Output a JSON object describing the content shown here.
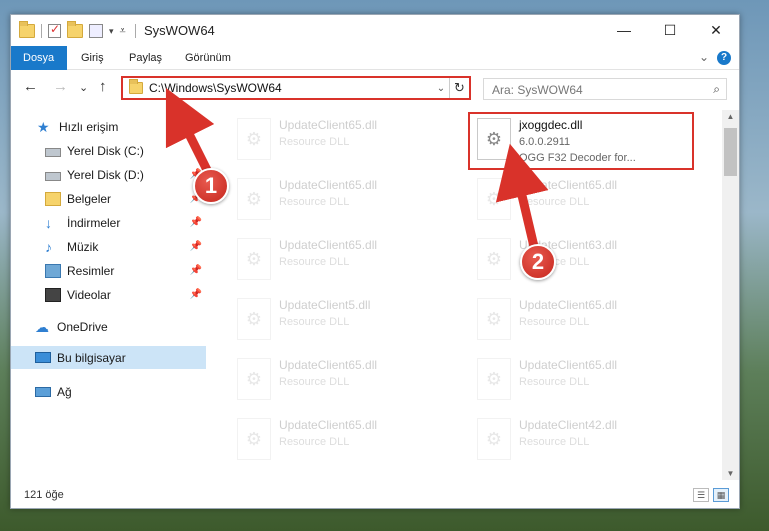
{
  "window": {
    "title": "SysWOW64",
    "minimize": "—",
    "maximize": "☐",
    "close": "✕"
  },
  "ribbon": {
    "tabs": [
      "Dosya",
      "Giriş",
      "Paylaş",
      "Görünüm"
    ],
    "expand": "⌄",
    "help": "?"
  },
  "nav": {
    "back": "←",
    "forward": "→",
    "recent": "⌄",
    "up": "↑",
    "address": "C:\\Windows\\SysWOW64",
    "address_chevron": "⌄",
    "refresh": "↻",
    "search_placeholder": "Ara: SysWOW64",
    "search_icon": "⌕"
  },
  "sidebar": {
    "items": [
      {
        "label": "Hızlı erişim",
        "icon": "star-icon"
      },
      {
        "label": "Yerel Disk (C:)",
        "icon": "disk-icon"
      },
      {
        "label": "Yerel Disk (D:)",
        "icon": "disk-icon"
      },
      {
        "label": "Belgeler",
        "icon": "documents-icon"
      },
      {
        "label": "İndirmeler",
        "icon": "downloads-icon"
      },
      {
        "label": "Müzik",
        "icon": "music-icon"
      },
      {
        "label": "Resimler",
        "icon": "pictures-icon"
      },
      {
        "label": "Videolar",
        "icon": "videos-icon"
      },
      {
        "label": "OneDrive",
        "icon": "cloud-icon"
      },
      {
        "label": "Bu bilgisayar",
        "icon": "computer-icon"
      },
      {
        "label": "Ağ",
        "icon": "network-icon"
      }
    ]
  },
  "files": {
    "highlighted": {
      "name": "jxoggdec.dll",
      "version": "6.0.0.2911",
      "description": "OGG F32 Decoder for..."
    },
    "left": [
      {
        "name": "UpdateClient65.dll",
        "desc": "Resource DLL"
      },
      {
        "name": "UpdateClient65.dll",
        "desc": "Resource DLL"
      },
      {
        "name": "UpdateClient65.dll",
        "desc": "Resource DLL"
      },
      {
        "name": "UpdateClient5.dll",
        "desc": "Resource DLL"
      },
      {
        "name": "UpdateClient65.dll",
        "desc": "Resource DLL"
      },
      {
        "name": "UpdateClient65.dll",
        "desc": "Resource DLL"
      }
    ],
    "right": [
      {
        "name": "UpdateClient65.dll",
        "desc": "Resource DLL"
      },
      {
        "name": "UpdateClient63.dll",
        "desc": "Resource DLL"
      },
      {
        "name": "UpdateClient65.dll",
        "desc": "Resource DLL"
      },
      {
        "name": "UpdateClient65.dll",
        "desc": "Resource DLL"
      },
      {
        "name": "UpdateClient42.dll",
        "desc": "Resource DLL"
      }
    ]
  },
  "status": {
    "count": "121 öğe"
  },
  "annotations": {
    "step1": "1",
    "step2": "2",
    "color": "#d9322a"
  }
}
